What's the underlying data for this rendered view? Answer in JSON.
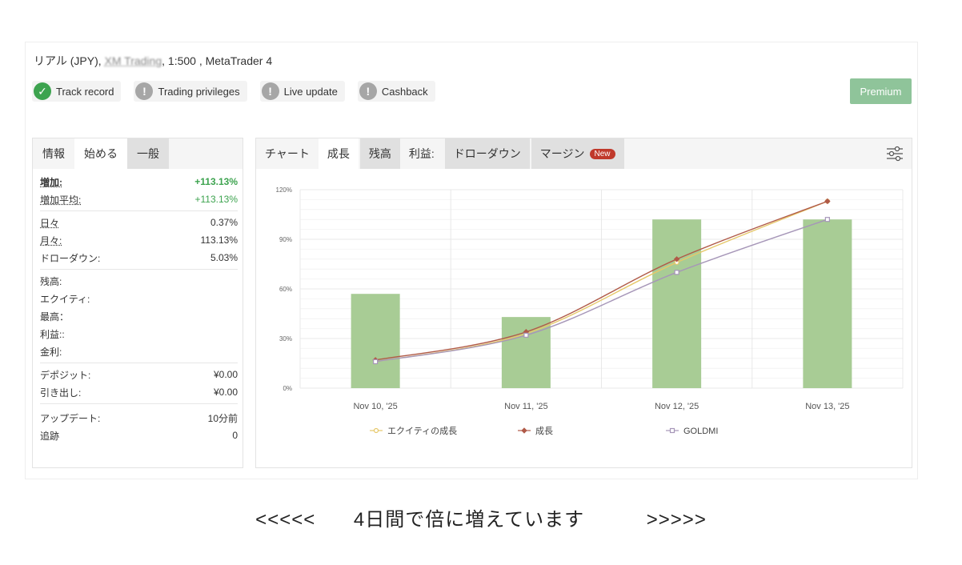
{
  "account": {
    "type": "リアル (JPY),",
    "broker_blurred": "XM Trading",
    "details": ", 1:500 , MetaTrader 4"
  },
  "badges": [
    {
      "label": "Track record",
      "status": "ok",
      "icon": "check-icon"
    },
    {
      "label": "Trading privileges",
      "status": "warn",
      "icon": "exclamation-icon"
    },
    {
      "label": "Live update",
      "status": "warn",
      "icon": "exclamation-icon"
    },
    {
      "label": "Cashback",
      "status": "warn",
      "icon": "exclamation-icon"
    }
  ],
  "premium_label": "Premium",
  "left_tabs": [
    "情報",
    "始める",
    "一般"
  ],
  "stats": {
    "gain_label": "増加:",
    "gain_value": "+113.13%",
    "avg_gain_label": "増加平均:",
    "avg_gain_value": "+113.13%",
    "daily_label": "日々",
    "daily_value": "0.37%",
    "monthly_label": "月々:",
    "monthly_value": "113.13%",
    "drawdown_label": "ドローダウン:",
    "drawdown_value": "5.03%",
    "balance_label": "残高:",
    "equity_label": "エクイティ:",
    "highest_label": "最高：",
    "profit_label": "利益::",
    "interest_label": "金利:",
    "deposit_label": "デポジット:",
    "deposit_value": "¥0.00",
    "withdraw_label": "引き出し:",
    "withdraw_value": "¥0.00",
    "update_label": "アップデート:",
    "update_value": "10分前",
    "tracking_label": "追跡",
    "tracking_value": "0"
  },
  "right_tabs": {
    "chart": "チャート",
    "growth": "成長",
    "balance": "残高",
    "profit": "利益:",
    "drawdown": "ドローダウン",
    "margin": "マージン",
    "new_tag": "New"
  },
  "chart_data": {
    "type": "bar",
    "categories": [
      "Nov 10, '25",
      "Nov 11, '25",
      "Nov 12, '25",
      "Nov 13, '25"
    ],
    "y_ticks": [
      "0%",
      "30%",
      "60%",
      "90%",
      "120%"
    ],
    "ylim": [
      0,
      120
    ],
    "bars": [
      57,
      43,
      102,
      102
    ],
    "bar_color": "#a8cc95",
    "series": [
      {
        "name": "エクイティの成長",
        "values": [
          16,
          33,
          76,
          113
        ],
        "color": "#e6c86a",
        "marker": "circle"
      },
      {
        "name": "成長",
        "values": [
          17,
          34,
          78,
          113
        ],
        "color": "#b05a48",
        "marker": "diamond"
      },
      {
        "name": "GOLDMI",
        "values": [
          16,
          32,
          70,
          102
        ],
        "color": "#a696b8",
        "marker": "square"
      }
    ],
    "grid": true,
    "legend": "bottom"
  },
  "footer": {
    "left_arrows": "<<<<<",
    "message": "4日間で倍に増えています",
    "right_arrows": ">>>>>"
  }
}
